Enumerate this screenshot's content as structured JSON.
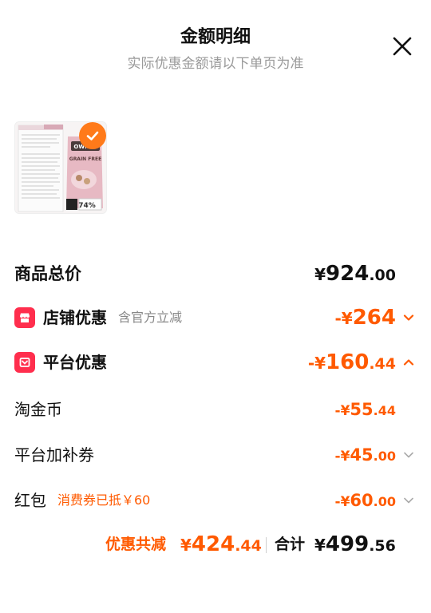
{
  "header": {
    "title": "金额明细",
    "subtitle": "实际优惠金额请以下单页为准"
  },
  "product": {
    "image_icon": "product-thumbnail",
    "badge_icon": "check-icon",
    "brand_text": "OWNAT",
    "pack_text": "GRAIN FREE",
    "percent_text": "74%"
  },
  "rows": {
    "total": {
      "label": "商品总价",
      "currency": "¥",
      "integer": "924",
      "decimal": ".00"
    },
    "store": {
      "label": "店铺优惠",
      "hint": "含官方立减",
      "currency": "-¥",
      "integer": "264",
      "decimal": "",
      "icon": "store-icon",
      "chevron": "chevron-down-icon"
    },
    "platform": {
      "label": "平台优惠",
      "currency": "-¥",
      "integer": "160",
      "decimal": ".44",
      "icon": "gift-icon",
      "chevron": "chevron-up-icon"
    },
    "taojinbi": {
      "label": "淘金币",
      "currency": "-¥",
      "integer": "55",
      "decimal": ".44"
    },
    "coupon": {
      "label": "平台加补券",
      "currency": "-¥",
      "integer": "45",
      "decimal": ".00",
      "chevron": "chevron-down-icon"
    },
    "redpacket": {
      "label": "红包",
      "note": "消费券已抵￥60",
      "currency": "-¥",
      "integer": "60",
      "decimal": ".00",
      "chevron": "chevron-down-icon"
    }
  },
  "summary": {
    "discount_label": "优惠共减",
    "discount_currency": "¥",
    "discount_integer": "424",
    "discount_decimal": ".44",
    "total_label": "合计",
    "total_currency": "¥",
    "total_integer": "499",
    "total_decimal": ".56"
  },
  "colors": {
    "accent": "#ff5a00",
    "badge_red": "#ff2e4d",
    "check_orange": "#ff7a1a",
    "subtitle_gray": "#9a9a9a"
  }
}
